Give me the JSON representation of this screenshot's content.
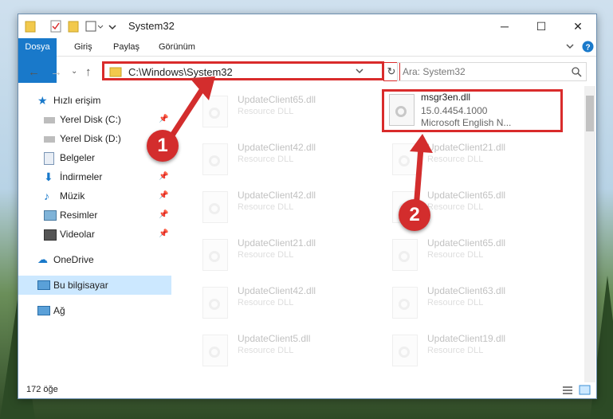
{
  "window": {
    "title": "System32"
  },
  "ribbon": {
    "tabs": [
      "Dosya",
      "Giriş",
      "Paylaş",
      "Görünüm"
    ]
  },
  "address": {
    "path": "C:\\Windows\\System32"
  },
  "search": {
    "placeholder": "Ara: System32"
  },
  "sidebar": {
    "items": [
      {
        "label": "Hızlı erişim",
        "icon": "star-icon",
        "pinned": false
      },
      {
        "label": "Yerel Disk (C:)",
        "icon": "drive-icon",
        "pinned": true
      },
      {
        "label": "Yerel Disk (D:)",
        "icon": "drive-icon",
        "pinned": true
      },
      {
        "label": "Belgeler",
        "icon": "document-icon",
        "pinned": true
      },
      {
        "label": "İndirmeler",
        "icon": "download-icon",
        "pinned": true
      },
      {
        "label": "Müzik",
        "icon": "music-icon",
        "pinned": true
      },
      {
        "label": "Resimler",
        "icon": "pictures-icon",
        "pinned": true
      },
      {
        "label": "Videolar",
        "icon": "video-icon",
        "pinned": true
      },
      {
        "label": "OneDrive",
        "icon": "cloud-icon",
        "pinned": false
      },
      {
        "label": "Bu bilgisayar",
        "icon": "computer-icon",
        "pinned": false,
        "selected": true
      },
      {
        "label": "Ağ",
        "icon": "network-icon",
        "pinned": false
      }
    ]
  },
  "files": {
    "left": [
      {
        "name": "UpdateClient65.dll",
        "desc": "Resource DLL"
      },
      {
        "name": "UpdateClient42.dll",
        "desc": "Resource DLL"
      },
      {
        "name": "UpdateClient42.dll",
        "desc": "Resource DLL"
      },
      {
        "name": "UpdateClient21.dll",
        "desc": "Resource DLL"
      },
      {
        "name": "UpdateClient42.dll",
        "desc": "Resource DLL"
      },
      {
        "name": "UpdateClient5.dll",
        "desc": "Resource DLL"
      }
    ],
    "right": [
      {
        "name": "UpdateClient21.dll",
        "desc": "Resource DLL"
      },
      {
        "name": "UpdateClient65.dll",
        "desc": "Resource DLL"
      },
      {
        "name": "UpdateClient65.dll",
        "desc": "Resource DLL"
      },
      {
        "name": "UpdateClient63.dll",
        "desc": "Resource DLL"
      },
      {
        "name": "UpdateClient19.dll",
        "desc": "Resource DLL"
      }
    ],
    "highlighted": {
      "name": "msgr3en.dll",
      "version": "15.0.4454.1000",
      "company": "Microsoft English N..."
    }
  },
  "status": {
    "count": "172 öğe"
  },
  "badges": [
    "1",
    "2"
  ],
  "colors": {
    "accent": "#1979ca",
    "highlight": "#d92b2b"
  }
}
